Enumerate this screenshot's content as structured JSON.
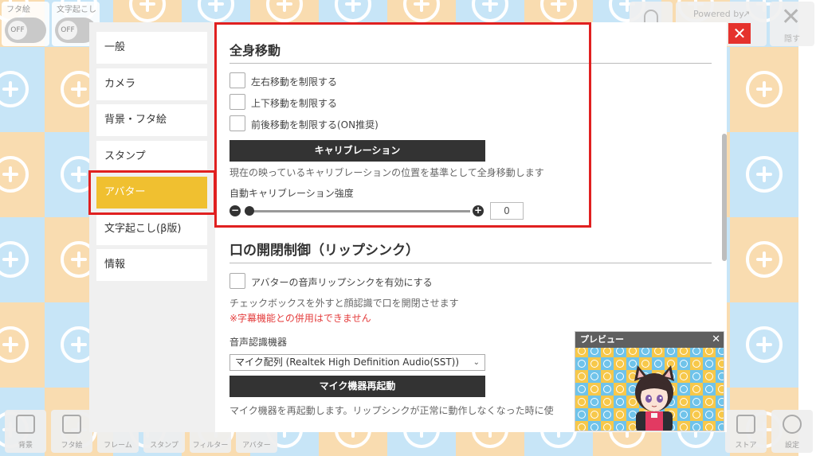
{
  "top_toggles": [
    {
      "label": "フタ絵",
      "state": "OFF"
    },
    {
      "label": "文字起こし",
      "state": "OFF"
    }
  ],
  "top_right": {
    "powered_by": "Powered by",
    "hide_label": "隠す",
    "hide_icon": "close-icon"
  },
  "sidebar": {
    "items": [
      {
        "label": "一般"
      },
      {
        "label": "カメラ"
      },
      {
        "label": "背景・フタ絵"
      },
      {
        "label": "スタンプ"
      },
      {
        "label": "アバター"
      },
      {
        "label": "文字起こし(β版)"
      },
      {
        "label": "情報"
      }
    ],
    "active_index": 4
  },
  "whole_body": {
    "title": "全身移動",
    "checkboxes": [
      {
        "label": "左右移動を制限する",
        "checked": false
      },
      {
        "label": "上下移動を制限する",
        "checked": false
      },
      {
        "label": "前後移動を制限する(ON推奨)",
        "checked": false
      }
    ],
    "calibration_button": "キャリブレーション",
    "calibration_note": "現在の映っているキャリブレーションの位置を基準として全身移動します",
    "auto_strength_label": "自動キャリブレーション強度",
    "auto_strength_value": "0"
  },
  "lipsync": {
    "title": "口の開閉制御（リップシンク）",
    "checkbox_label": "アバターの音声リップシンクを有効にする",
    "note": "チェックボックスを外すと顔認識で口を開閉させます",
    "warning": "※字幕機能との併用はできません",
    "device_label": "音声認識機器",
    "device_value": "マイク配列 (Realtek High Definition Audio(SST))",
    "restart_button": "マイク機器再起動",
    "restart_note": "マイク機器を再起動します。リップシンクが正常に動作しなくなった時に使"
  },
  "preview": {
    "title": "プレビュー"
  },
  "bottom_toolbar": [
    {
      "label": "背景"
    },
    {
      "label": "フタ絵"
    },
    {
      "label": "フレーム"
    },
    {
      "label": "スタンプ"
    },
    {
      "label": "フィルター"
    },
    {
      "label": "アバター"
    }
  ],
  "bottom_right": [
    {
      "label": "ストア"
    },
    {
      "label": "設定"
    }
  ],
  "colors": {
    "accent": "#f0c030",
    "highlight": "#e02020",
    "close_red": "#e5322d",
    "dark_button": "#333333",
    "warning": "#e43d3d"
  }
}
